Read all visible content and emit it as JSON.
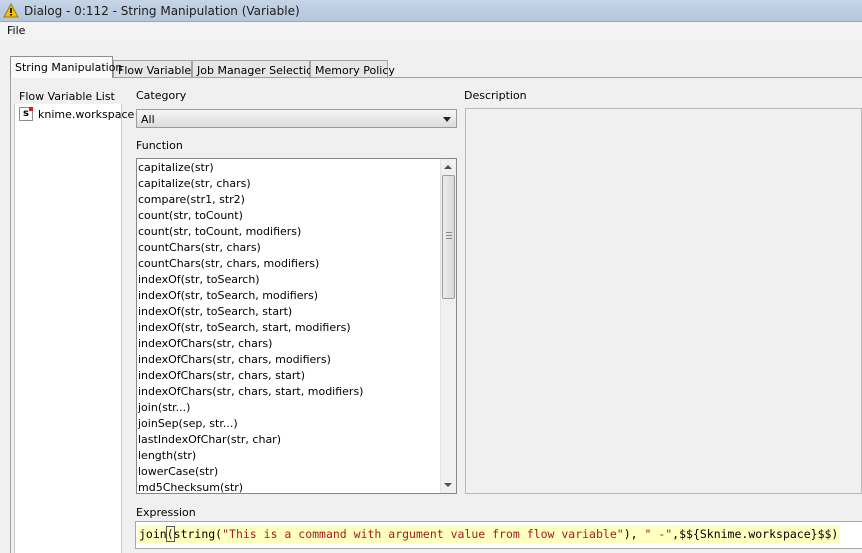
{
  "window": {
    "title": "Dialog - 0:112 - String Manipulation (Variable)"
  },
  "menubar": {
    "file": "File"
  },
  "tabs": [
    {
      "label": "String Manipulation",
      "active": true
    },
    {
      "label": "Flow Variables",
      "active": false
    },
    {
      "label": "Job Manager Selection",
      "active": false
    },
    {
      "label": "Memory Policy",
      "active": false
    }
  ],
  "flow_variables": {
    "heading": "Flow Variable List",
    "items": [
      {
        "type_icon": "string-variable-icon",
        "icon_letter": "s",
        "name": "knime.workspace"
      }
    ]
  },
  "category": {
    "label": "Category",
    "selected": "All"
  },
  "functions": {
    "label": "Function",
    "items": [
      "capitalize(str)",
      "capitalize(str, chars)",
      "compare(str1, str2)",
      "count(str, toCount)",
      "count(str, toCount, modifiers)",
      "countChars(str, chars)",
      "countChars(str, chars, modifiers)",
      "indexOf(str, toSearch)",
      "indexOf(str, toSearch, modifiers)",
      "indexOf(str, toSearch, start)",
      "indexOf(str, toSearch, start, modifiers)",
      "indexOfChars(str, chars)",
      "indexOfChars(str, chars, modifiers)",
      "indexOfChars(str, chars, start)",
      "indexOfChars(str, chars, start, modifiers)",
      "join(str...)",
      "joinSep(sep, str...)",
      "lastIndexOfChar(str, char)",
      "length(str)",
      "lowerCase(str)",
      "md5Checksum(str)"
    ]
  },
  "description": {
    "label": "Description"
  },
  "expression": {
    "label": "Expression",
    "parts": [
      {
        "text": "join",
        "kind": "plain"
      },
      {
        "text": "(",
        "kind": "paren"
      },
      {
        "text": "string(",
        "kind": "plain"
      },
      {
        "text": "\"This is a command with argument value from flow variable\"",
        "kind": "string"
      },
      {
        "text": "), ",
        "kind": "plain"
      },
      {
        "text": "\" -\"",
        "kind": "string"
      },
      {
        "text": ",$${Sknime.workspace}$$)",
        "kind": "plain"
      }
    ]
  },
  "colors": {
    "title_gradient_top": "#c6d4e6",
    "expression_highlight": "#ffffc0",
    "string_literal": "#a41d23",
    "warning_icon": "#f4c20d"
  }
}
